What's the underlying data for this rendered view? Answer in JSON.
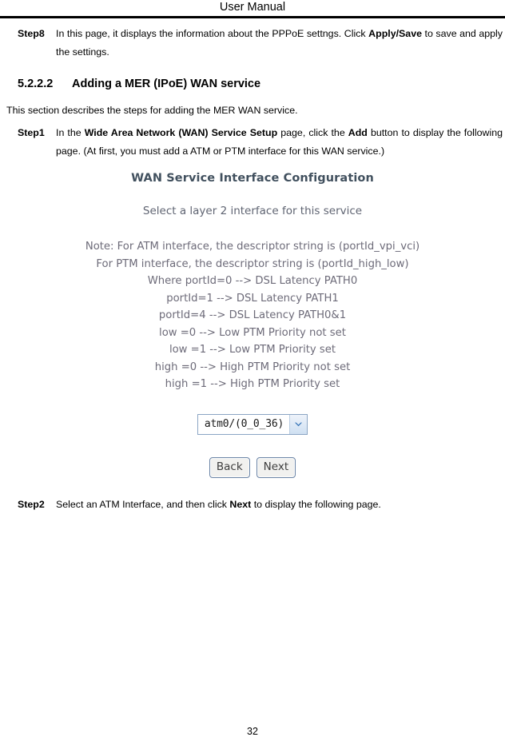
{
  "header": {
    "title": "User Manual"
  },
  "steps": [
    {
      "label": "Step8",
      "segments": [
        {
          "text": "In this page, it displays the information about the PPPoE settngs. Click ",
          "bold": false
        },
        {
          "text": "Apply/Save",
          "bold": true
        },
        {
          "text": " to save and apply the settings.",
          "bold": false
        }
      ]
    }
  ],
  "section": {
    "number": "5.2.2.2",
    "title": "Adding a MER (IPoE) WAN service"
  },
  "intro": "This section describes the steps for adding the MER WAN service.",
  "step1": {
    "label": "Step1",
    "segments": [
      {
        "text": "In the ",
        "bold": false
      },
      {
        "text": "Wide Area Network (WAN) Service Setup",
        "bold": true
      },
      {
        "text": " page, click the ",
        "bold": false
      },
      {
        "text": "Add",
        "bold": true
      },
      {
        "text": " button to display the following page. (At first, you must add a ATM or PTM interface for this WAN service.)",
        "bold": false
      }
    ]
  },
  "embedded_screenshot": {
    "title": "WAN Service Interface Configuration",
    "subtitle": "Select a layer 2 interface for this service",
    "note_lines": [
      "Note: For ATM interface, the descriptor string is (portId_vpi_vci)",
      "For PTM interface, the descriptor string is (portId_high_low)",
      "Where portId=0 --> DSL Latency PATH0",
      "portId=1 --> DSL Latency PATH1",
      "portId=4 --> DSL Latency PATH0&1",
      "low =0 --> Low PTM Priority not set",
      "low =1 --> Low PTM Priority set",
      "high =0 --> High PTM Priority not set",
      "high =1 --> High PTM Priority set"
    ],
    "interface_select": {
      "value": "atm0/(0_0_36)",
      "options": [
        "atm0/(0_0_36)"
      ]
    },
    "buttons": {
      "back": "Back",
      "next": "Next"
    },
    "colors": {
      "title": "#41505e",
      "note": "#6d6b79",
      "select_border": "#8ba5c4",
      "arrow": "#2f6fb5"
    }
  },
  "step2": {
    "label": "Step2",
    "segments": [
      {
        "text": "Select an ATM Interface, and then click ",
        "bold": false
      },
      {
        "text": "Next",
        "bold": true
      },
      {
        "text": " to display the following page.",
        "bold": false
      }
    ]
  },
  "footer": {
    "page_number": "32"
  }
}
